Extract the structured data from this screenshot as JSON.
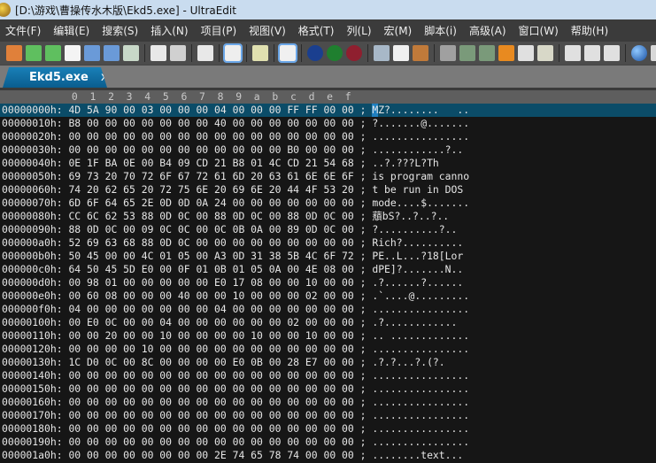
{
  "window": {
    "title": "[D:\\游戏\\曹操传水木版\\Ekd5.exe] - UltraEdit"
  },
  "menu": [
    "文件(F)",
    "编辑(E)",
    "搜索(S)",
    "插入(N)",
    "项目(P)",
    "视图(V)",
    "格式(T)",
    "列(L)",
    "宏(M)",
    "脚本(i)",
    "高级(A)",
    "窗口(W)",
    "帮助(H)"
  ],
  "toolbar": [
    {
      "icon": "new-template-icon",
      "color": "#e0803a"
    },
    {
      "icon": "back-arrow-icon",
      "color": "#5fbf5f"
    },
    {
      "icon": "forward-arrow-icon",
      "color": "#5fbf5f"
    },
    {
      "icon": "new-file-icon",
      "color": "#f4f4f4"
    },
    {
      "icon": "open-folder-icon",
      "color": "#6a9ad8"
    },
    {
      "icon": "open-recent-icon",
      "color": "#6a9ad8"
    },
    {
      "icon": "save-icon",
      "color": "#c8d8c8"
    },
    "sep",
    {
      "icon": "print-icon",
      "color": "#e8e8e8"
    },
    {
      "icon": "print-preview-icon",
      "color": "#d0d0d0"
    },
    "sep",
    {
      "icon": "word-wrap-icon",
      "color": "#e8e8e8"
    },
    "sep",
    {
      "icon": "hex-mode-icon",
      "color": "#eeeeee",
      "sel": true
    },
    "sep",
    {
      "icon": "column-mode-icon",
      "color": "#e0e0b0"
    },
    "sep",
    {
      "icon": "line-numbers-icon",
      "color": "#f0f0f0",
      "sel": true
    },
    "sep",
    {
      "icon": "uc-icon",
      "color": "#1a3f8f"
    },
    {
      "icon": "uf-icon",
      "color": "#1f7f2f"
    },
    {
      "icon": "us-icon",
      "color": "#8f1f2f"
    },
    "sep",
    {
      "icon": "cut-icon",
      "color": "#a8b8c8"
    },
    {
      "icon": "copy-icon",
      "color": "#f0f0f0"
    },
    {
      "icon": "paste-icon",
      "color": "#c07a3a"
    },
    "sep",
    {
      "icon": "find-icon",
      "color": "#a0a0a0"
    },
    {
      "icon": "find-prev-icon",
      "color": "#7a9a7a"
    },
    {
      "icon": "find-next-icon",
      "color": "#7a9a7a"
    },
    {
      "icon": "bookmark-icon",
      "color": "#e88a20"
    },
    {
      "icon": "highlight-icon",
      "color": "#e0e0e0"
    },
    {
      "icon": "find-in-files-icon",
      "color": "#d8d8c8"
    },
    "sep",
    {
      "icon": "tile-horizontal-icon",
      "color": "#e0e0e0"
    },
    {
      "icon": "tile-vertical-icon",
      "color": "#e0e0e0"
    },
    {
      "icon": "cascade-icon",
      "color": "#e0e0e0"
    },
    "sep",
    {
      "icon": "web-browser-icon",
      "color": "#2a6fd0"
    },
    {
      "icon": "web-preview-icon",
      "color": "#d8d8d8"
    }
  ],
  "tab": {
    "label": "Ekd5.exe",
    "close": "x"
  },
  "ruler": [
    "0",
    "1",
    "2",
    "3",
    "4",
    "5",
    "6",
    "7",
    "8",
    "9",
    "a",
    "b",
    "c",
    "d",
    "e",
    "f"
  ],
  "rows": [
    {
      "o": "00000000h:",
      "h": "4D 5A 90 00 03 00 00 00 04 00 00 00 FF FF 00 00",
      "a": "MZ?........   .."
    },
    {
      "o": "00000010h:",
      "h": "B8 00 00 00 00 00 00 00 40 00 00 00 00 00 00 00",
      "a": "?.......@......."
    },
    {
      "o": "00000020h:",
      "h": "00 00 00 00 00 00 00 00 00 00 00 00 00 00 00 00",
      "a": "................"
    },
    {
      "o": "00000030h:",
      "h": "00 00 00 00 00 00 00 00 00 00 00 00 B0 00 00 00",
      "a": "............?.."
    },
    {
      "o": "00000040h:",
      "h": "0E 1F BA 0E 00 B4 09 CD 21 B8 01 4C CD 21 54 68",
      "a": "..?.???L?Th"
    },
    {
      "o": "00000050h:",
      "h": "69 73 20 70 72 6F 67 72 61 6D 20 63 61 6E 6E 6F",
      "a": "is program canno"
    },
    {
      "o": "00000060h:",
      "h": "74 20 62 65 20 72 75 6E 20 69 6E 20 44 4F 53 20",
      "a": "t be run in DOS "
    },
    {
      "o": "00000070h:",
      "h": "6D 6F 64 65 2E 0D 0D 0A 24 00 00 00 00 00 00 00",
      "a": "mode....$......."
    },
    {
      "o": "00000080h:",
      "h": "CC 6C 62 53 88 0D 0C 00 88 0D 0C 00 88 0D 0C 00",
      "a": "蘈bS?..?..?.."
    },
    {
      "o": "00000090h:",
      "h": "88 0D 0C 00 09 0C 0C 00 0C 0B 0A 00 89 0D 0C 00",
      "a": "?..........?.."
    },
    {
      "o": "000000a0h:",
      "h": "52 69 63 68 88 0D 0C 00 00 00 00 00 00 00 00 00",
      "a": "Rich?.........."
    },
    {
      "o": "000000b0h:",
      "h": "50 45 00 00 4C 01 05 00 A3 0D 31 38 5B 4C 6F 72",
      "a": "PE..L...?18[Lor"
    },
    {
      "o": "000000c0h:",
      "h": "64 50 45 5D E0 00 0F 01 0B 01 05 0A 00 4E 08 00",
      "a": "dPE]?.......N.."
    },
    {
      "o": "000000d0h:",
      "h": "00 98 01 00 00 00 00 00 E0 17 08 00 00 10 00 00",
      "a": ".?......?......"
    },
    {
      "o": "000000e0h:",
      "h": "00 60 08 00 00 00 40 00 00 10 00 00 00 02 00 00",
      "a": ".`....@........."
    },
    {
      "o": "000000f0h:",
      "h": "04 00 00 00 00 00 00 00 04 00 00 00 00 00 00 00",
      "a": "................"
    },
    {
      "o": "00000100h:",
      "h": "00 E0 0C 00 00 04 00 00 00 00 00 00 02 00 00 00",
      "a": ".?............"
    },
    {
      "o": "00000110h:",
      "h": "00 00 20 00 00 10 00 00 00 00 10 00 00 10 00 00",
      "a": ".. ............."
    },
    {
      "o": "00000120h:",
      "h": "00 00 00 00 10 00 00 00 00 00 00 00 00 00 00 00",
      "a": "................"
    },
    {
      "o": "00000130h:",
      "h": "1C D0 0C 00 8C 00 00 00 00 E0 0B 00 28 E7 00 00",
      "a": ".?.?...?.(?."
    },
    {
      "o": "00000140h:",
      "h": "00 00 00 00 00 00 00 00 00 00 00 00 00 00 00 00",
      "a": "................"
    },
    {
      "o": "00000150h:",
      "h": "00 00 00 00 00 00 00 00 00 00 00 00 00 00 00 00",
      "a": "................"
    },
    {
      "o": "00000160h:",
      "h": "00 00 00 00 00 00 00 00 00 00 00 00 00 00 00 00",
      "a": "................"
    },
    {
      "o": "00000170h:",
      "h": "00 00 00 00 00 00 00 00 00 00 00 00 00 00 00 00",
      "a": "................"
    },
    {
      "o": "00000180h:",
      "h": "00 00 00 00 00 00 00 00 00 00 00 00 00 00 00 00",
      "a": "................"
    },
    {
      "o": "00000190h:",
      "h": "00 00 00 00 00 00 00 00 00 00 00 00 00 00 00 00",
      "a": "................"
    },
    {
      "o": "000001a0h:",
      "h": "00 00 00 00 00 00 00 00 2E 74 65 78 74 00 00 00",
      "a": "........text..."
    }
  ]
}
